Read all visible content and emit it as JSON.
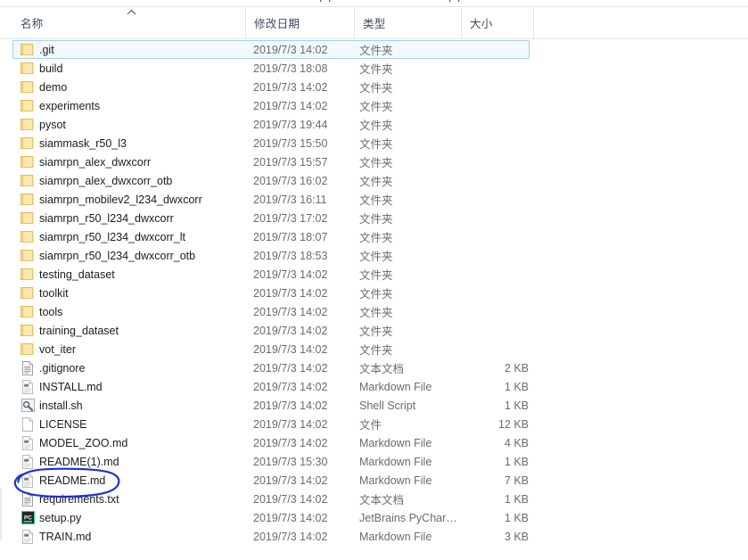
{
  "window": {
    "title": "File Explorer list view",
    "background_color": "#ffffff"
  },
  "columns": {
    "name": "名称",
    "date_modified": "修改日期",
    "type": "类型",
    "size": "大小",
    "sort_indicator": "ascending-caret"
  },
  "selection": {
    "selected_row_name": ".git",
    "highlight_fill": "#f2f8fd",
    "highlight_border": "#a7d0ee"
  },
  "annotation": {
    "shape": "hand-drawn-ellipse",
    "color": "#1f2fd0",
    "target": "README.md"
  },
  "rows": [
    {
      "icon": "folder-icon",
      "name": ".git",
      "date": "2019/7/3 14:02",
      "type": "文件夹",
      "size": ""
    },
    {
      "icon": "folder-icon",
      "name": "build",
      "date": "2019/7/3 18:08",
      "type": "文件夹",
      "size": ""
    },
    {
      "icon": "folder-icon",
      "name": "demo",
      "date": "2019/7/3 14:02",
      "type": "文件夹",
      "size": ""
    },
    {
      "icon": "folder-icon",
      "name": "experiments",
      "date": "2019/7/3 14:02",
      "type": "文件夹",
      "size": ""
    },
    {
      "icon": "folder-icon",
      "name": "pysot",
      "date": "2019/7/3 19:44",
      "type": "文件夹",
      "size": ""
    },
    {
      "icon": "folder-icon",
      "name": "siammask_r50_l3",
      "date": "2019/7/3 15:50",
      "type": "文件夹",
      "size": ""
    },
    {
      "icon": "folder-icon",
      "name": "siamrpn_alex_dwxcorr",
      "date": "2019/7/3 15:57",
      "type": "文件夹",
      "size": ""
    },
    {
      "icon": "folder-icon",
      "name": "siamrpn_alex_dwxcorr_otb",
      "date": "2019/7/3 16:02",
      "type": "文件夹",
      "size": ""
    },
    {
      "icon": "folder-icon",
      "name": "siamrpn_mobilev2_l234_dwxcorr",
      "date": "2019/7/3 16:11",
      "type": "文件夹",
      "size": ""
    },
    {
      "icon": "folder-icon",
      "name": "siamrpn_r50_l234_dwxcorr",
      "date": "2019/7/3 17:02",
      "type": "文件夹",
      "size": ""
    },
    {
      "icon": "folder-icon",
      "name": "siamrpn_r50_l234_dwxcorr_lt",
      "date": "2019/7/3 18:07",
      "type": "文件夹",
      "size": ""
    },
    {
      "icon": "folder-icon",
      "name": "siamrpn_r50_l234_dwxcorr_otb",
      "date": "2019/7/3 18:53",
      "type": "文件夹",
      "size": ""
    },
    {
      "icon": "folder-icon",
      "name": "testing_dataset",
      "date": "2019/7/3 14:02",
      "type": "文件夹",
      "size": ""
    },
    {
      "icon": "folder-icon",
      "name": "toolkit",
      "date": "2019/7/3 14:02",
      "type": "文件夹",
      "size": ""
    },
    {
      "icon": "folder-icon",
      "name": "tools",
      "date": "2019/7/3 14:02",
      "type": "文件夹",
      "size": ""
    },
    {
      "icon": "folder-icon",
      "name": "training_dataset",
      "date": "2019/7/3 14:02",
      "type": "文件夹",
      "size": ""
    },
    {
      "icon": "folder-icon",
      "name": "vot_iter",
      "date": "2019/7/3 14:02",
      "type": "文件夹",
      "size": ""
    },
    {
      "icon": "text-file-icon",
      "name": ".gitignore",
      "date": "2019/7/3 14:02",
      "type": "文本文档",
      "size": "2 KB"
    },
    {
      "icon": "markdown-file-icon",
      "name": "INSTALL.md",
      "date": "2019/7/3 14:02",
      "type": "Markdown File",
      "size": "1 KB"
    },
    {
      "icon": "shell-script-icon",
      "name": "install.sh",
      "date": "2019/7/3 14:02",
      "type": "Shell Script",
      "size": "1 KB"
    },
    {
      "icon": "blank-file-icon",
      "name": "LICENSE",
      "date": "2019/7/3 14:02",
      "type": "文件",
      "size": "12 KB"
    },
    {
      "icon": "markdown-file-icon",
      "name": "MODEL_ZOO.md",
      "date": "2019/7/3 14:02",
      "type": "Markdown File",
      "size": "4 KB"
    },
    {
      "icon": "markdown-file-icon",
      "name": "README(1).md",
      "date": "2019/7/3 15:30",
      "type": "Markdown File",
      "size": "1 KB"
    },
    {
      "icon": "markdown-file-icon",
      "name": "README.md",
      "date": "2019/7/3 14:02",
      "type": "Markdown File",
      "size": "7 KB"
    },
    {
      "icon": "text-file-icon",
      "name": "requirements.txt",
      "date": "2019/7/3 14:02",
      "type": "文本文档",
      "size": "1 KB"
    },
    {
      "icon": "pycharm-file-icon",
      "name": "setup.py",
      "date": "2019/7/3 14:02",
      "type": "JetBrains PyChar…",
      "size": "1 KB"
    },
    {
      "icon": "markdown-file-icon",
      "name": "TRAIN.md",
      "date": "2019/7/3 14:02",
      "type": "Markdown File",
      "size": "3 KB"
    }
  ]
}
